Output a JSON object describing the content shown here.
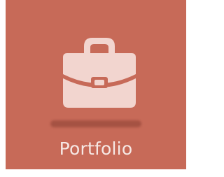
{
  "tile": {
    "label": "Portfolio",
    "icon": "briefcase-icon",
    "background_color": "#c76a58",
    "icon_color": "#f2d5cf"
  }
}
